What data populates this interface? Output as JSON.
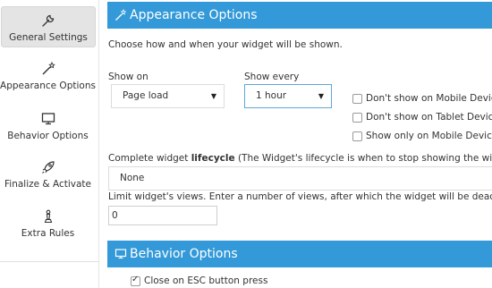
{
  "sidebar": {
    "items": [
      {
        "label": "General Settings",
        "icon": "wrench-icon",
        "active": true
      },
      {
        "label": "Appearance Options",
        "icon": "magic-wand-icon",
        "active": false
      },
      {
        "label": "Behavior Options",
        "icon": "monitor-icon",
        "active": false
      },
      {
        "label": "Finalize & Activate",
        "icon": "rocket-icon",
        "active": false
      },
      {
        "label": "Extra Rules",
        "icon": "chess-piece-icon",
        "active": false
      }
    ]
  },
  "appearance": {
    "title": "Appearance Options",
    "intro": "Choose how and when your widget will be shown.",
    "show_on": {
      "label": "Show on",
      "value": "Page load"
    },
    "show_every": {
      "label": "Show every",
      "value": "1 hour"
    },
    "checkboxes": [
      {
        "label": "Don't show on Mobile Devices",
        "checked": false
      },
      {
        "label": "Don't show on Tablet Devices",
        "checked": false
      },
      {
        "label": "Show only on Mobile Devices",
        "checked": false
      }
    ],
    "lifecycle": {
      "prefix": "Complete widget ",
      "bold": "lifecycle",
      "suffix": " (The Widget's lifecycle is when to stop showing the widget after a sp",
      "value": "None"
    },
    "limit": {
      "label": "Limit widget's views. Enter a number of views, after which the widget will be deactivated.",
      "value": "0"
    }
  },
  "behavior": {
    "title": "Behavior Options",
    "close_esc": {
      "label": "Close on ESC button press",
      "checked": true
    }
  },
  "colors": {
    "accent": "#3399d8",
    "active_nav_bg": "#e4e4e4"
  }
}
